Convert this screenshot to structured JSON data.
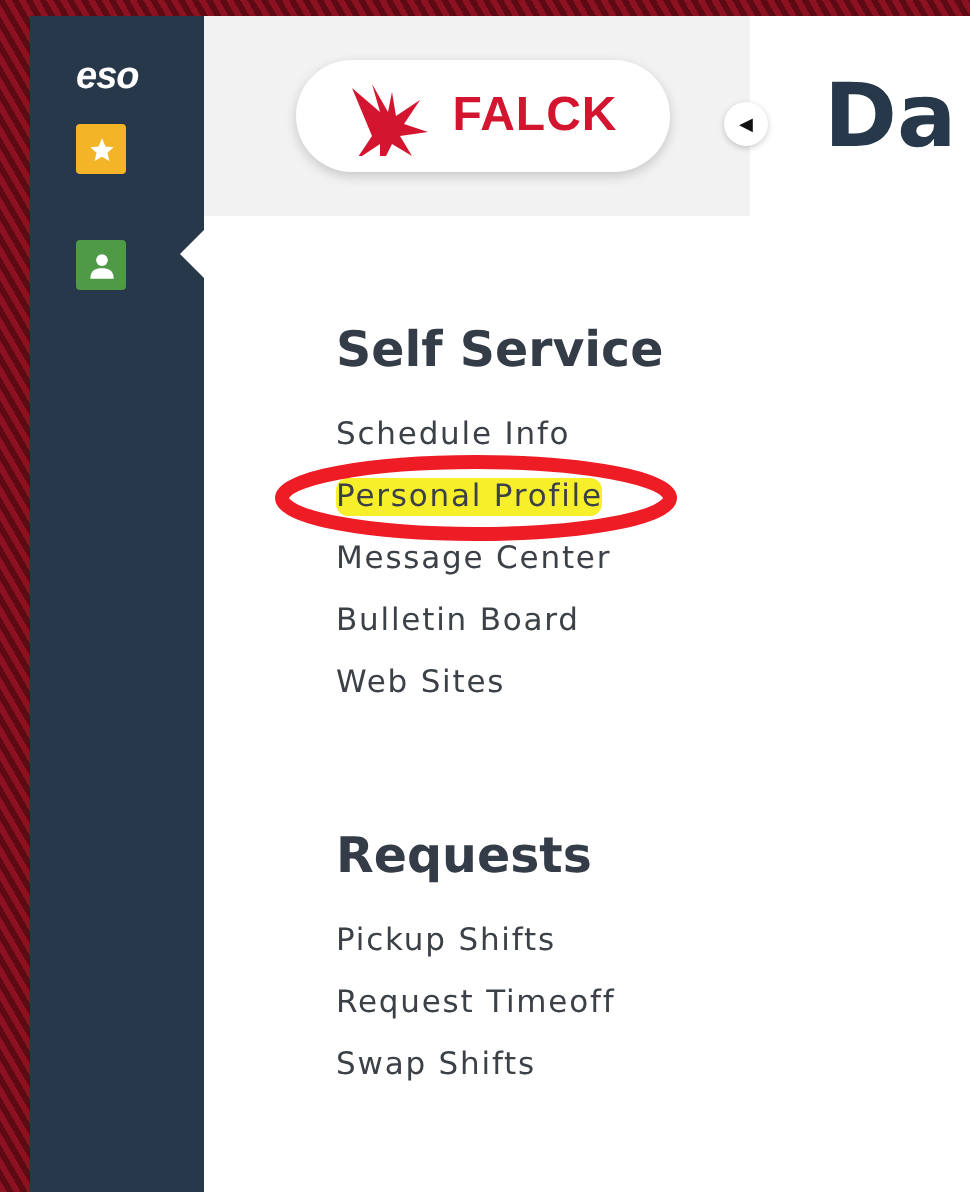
{
  "sidebar": {
    "logo": "eso",
    "buttons": [
      {
        "kind": "star",
        "selected": false
      },
      {
        "kind": "person",
        "selected": true
      }
    ]
  },
  "header": {
    "brand": "FALCK",
    "collapse_icon": "◀",
    "page_title": "Da"
  },
  "menu": {
    "sections": [
      {
        "title": "Self Service",
        "items": [
          {
            "label": "Schedule Info",
            "highlighted": false
          },
          {
            "label": "Personal Profile",
            "highlighted": true
          },
          {
            "label": "Message Center",
            "highlighted": false
          },
          {
            "label": "Bulletin Board",
            "highlighted": false
          },
          {
            "label": "Web Sites",
            "highlighted": false
          }
        ]
      },
      {
        "title": "Requests",
        "items": [
          {
            "label": "Pickup Shifts",
            "highlighted": false
          },
          {
            "label": "Request Timeoff",
            "highlighted": false
          },
          {
            "label": "Swap Shifts",
            "highlighted": false
          }
        ]
      }
    ]
  }
}
